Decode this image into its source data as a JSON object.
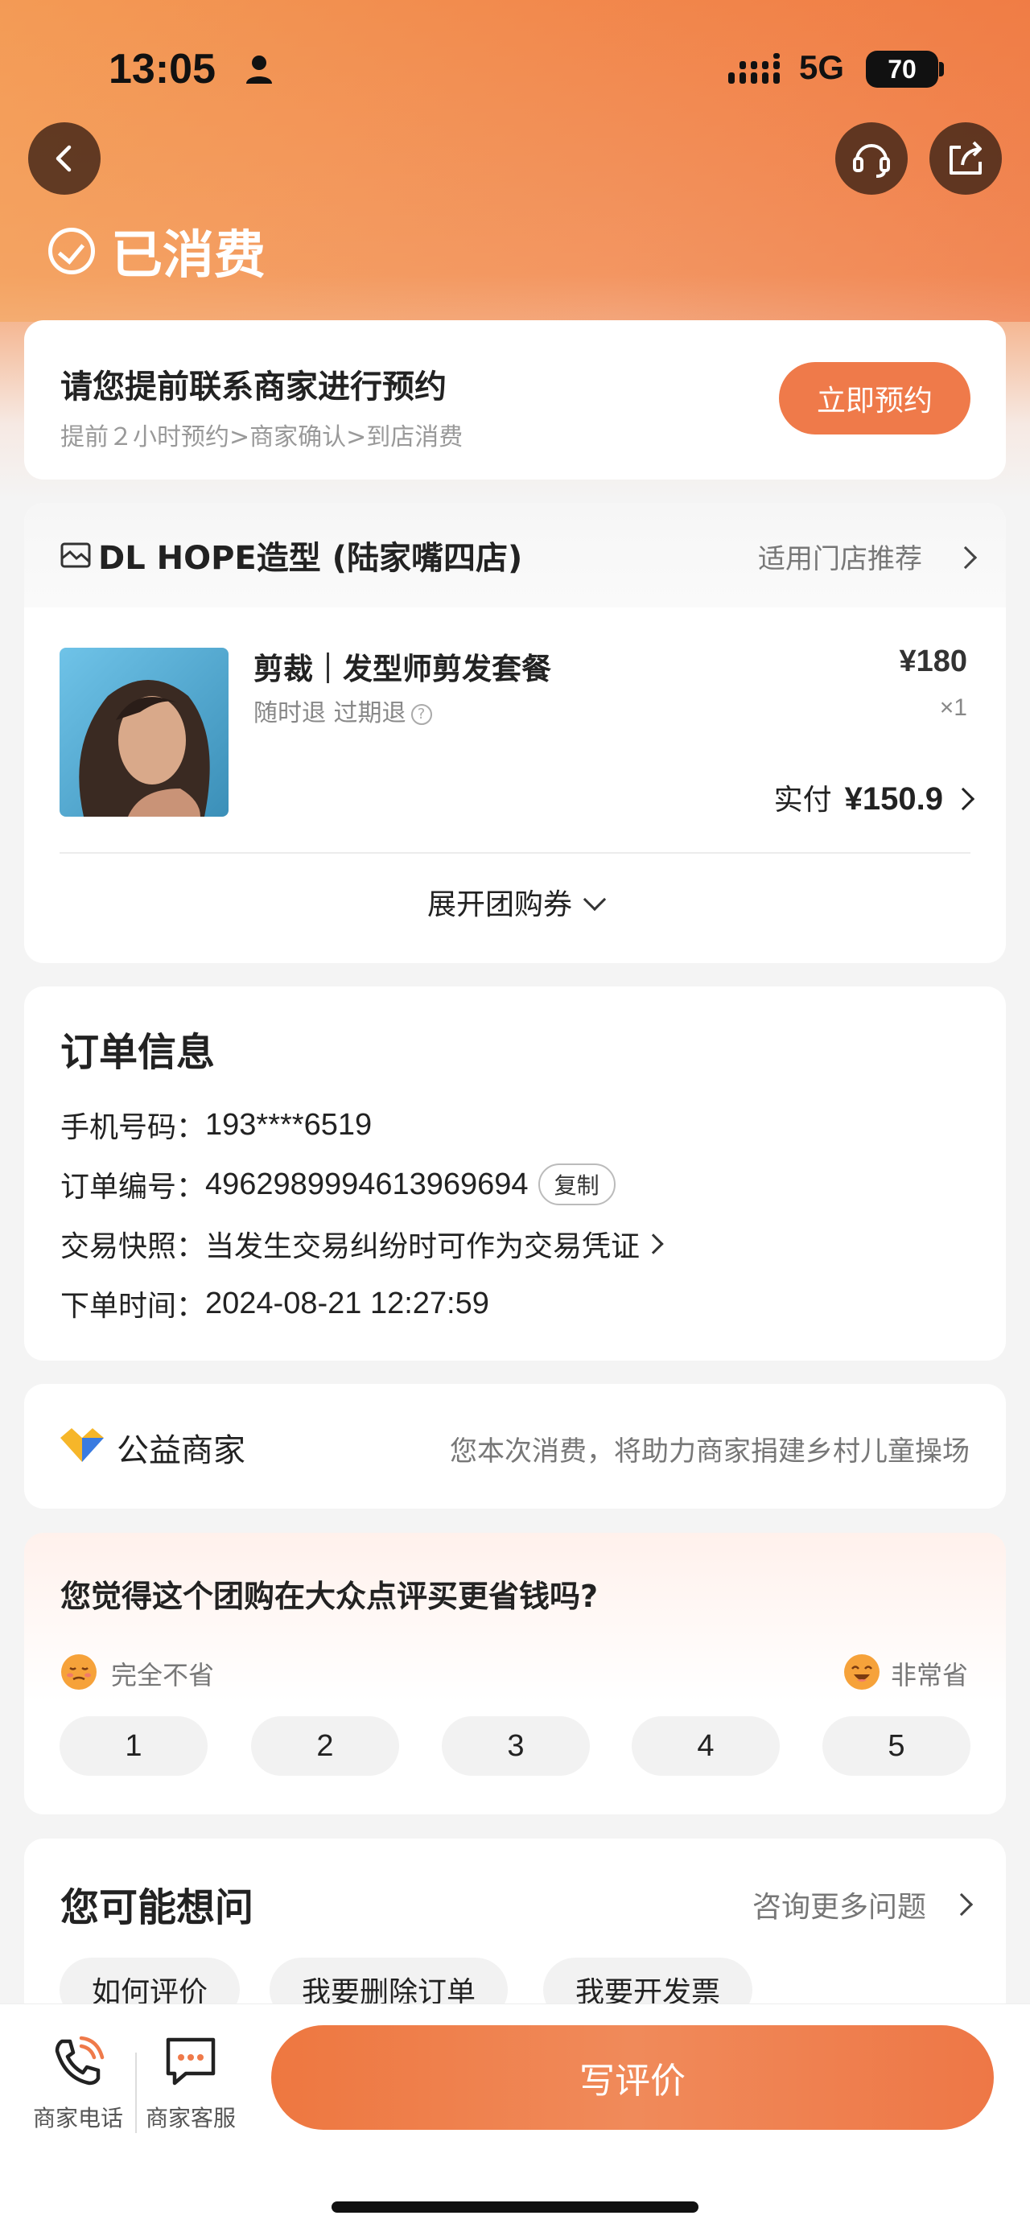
{
  "status_bar": {
    "time": "13:05",
    "network": "5G",
    "battery": "70"
  },
  "nav": {
    "back_icon": "chevron-left-icon",
    "support_icon": "headset-icon",
    "share_icon": "share-icon"
  },
  "order_state": {
    "title": "已消费"
  },
  "reservation": {
    "title": "请您提前联系商家进行预约",
    "steps": "提前２小时预约>商家确认>到店消费",
    "button": "立即预约"
  },
  "shop": {
    "name": "DL HOPE造型 (陆家嘴四店)",
    "store_recommend": "适用门店推荐"
  },
  "product": {
    "title": "剪裁｜发型师剪发套餐",
    "tags": "随时退  过期退",
    "price": "¥180",
    "qty": "×1",
    "paid_label": "实付",
    "paid_amount": "¥150.9",
    "expand_label": "展开团购券"
  },
  "order_info": {
    "title": "订单信息",
    "phone_label": "手机号码：",
    "phone": "193****6519",
    "order_no_label": "订单编号：",
    "order_no": "4962989994613969694",
    "copy_label": "复制",
    "snapshot_label": "交易快照：",
    "snapshot_text": "当发生交易纠纷时可作为交易凭证",
    "time_label": "下单时间：",
    "time": "2024-08-21 12:27:59"
  },
  "charity": {
    "title": "公益商家",
    "desc": "您本次消费，将助力商家捐建乡村儿童操场"
  },
  "survey": {
    "question": "您觉得这个团购在大众点评买更省钱吗?",
    "low_label": "完全不省",
    "high_label": "非常省",
    "options": [
      "1",
      "2",
      "3",
      "4",
      "5"
    ]
  },
  "faq": {
    "title": "您可能想问",
    "more": "咨询更多问题",
    "chips": [
      "如何评价",
      "我要删除订单",
      "我要开发票"
    ]
  },
  "bottom_bar": {
    "phone_label": "商家电话",
    "service_label": "商家客服",
    "review_button": "写评价"
  },
  "colors": {
    "accent": "#ef7a4a",
    "hero_orange": "#f28b4e"
  }
}
